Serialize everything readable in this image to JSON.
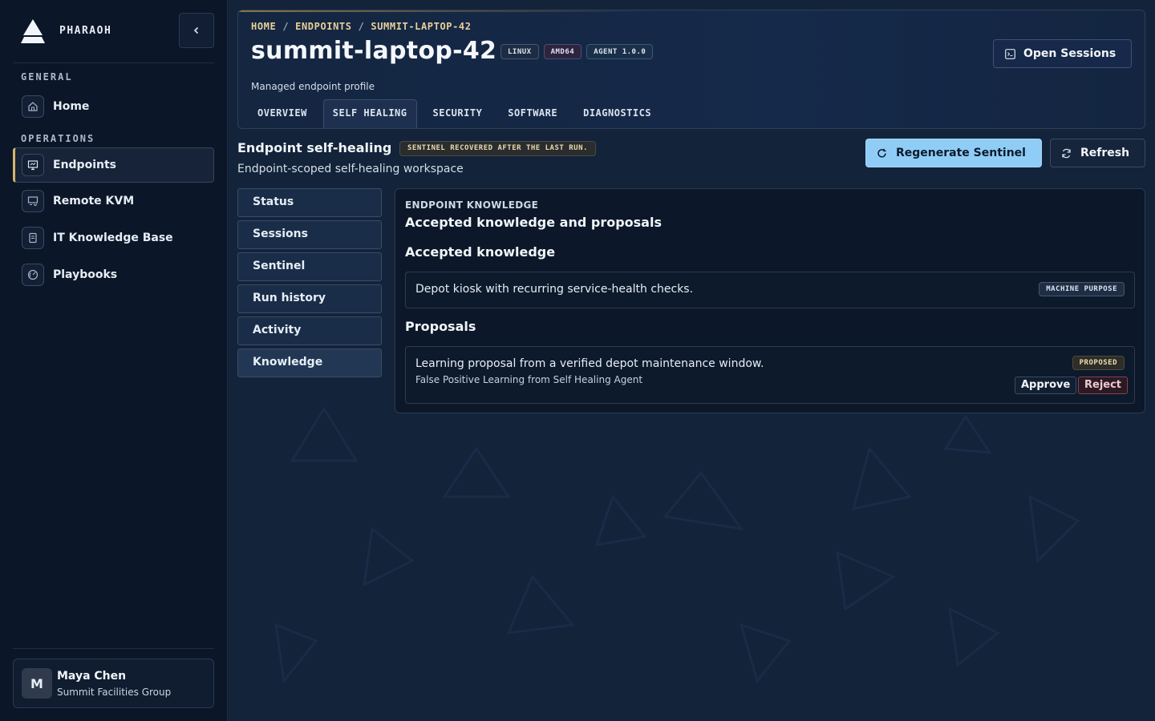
{
  "brand": {
    "name": "PHARAOH"
  },
  "sidebar": {
    "sections": [
      {
        "label": "GENERAL"
      },
      {
        "label": "OPERATIONS"
      }
    ],
    "items": [
      {
        "label": "Home",
        "icon": "home-icon"
      },
      {
        "label": "Endpoints",
        "icon": "monitor-icon",
        "active": true
      },
      {
        "label": "Remote KVM",
        "icon": "remote-screen-icon"
      },
      {
        "label": "IT Knowledge Base",
        "icon": "book-icon"
      },
      {
        "label": "Playbooks",
        "icon": "gauge-icon"
      }
    ],
    "user": {
      "initial": "M",
      "name": "Maya Chen",
      "org": "Summit Facilities Group"
    }
  },
  "header": {
    "breadcrumb": [
      "HOME",
      "ENDPOINTS",
      "SUMMIT-LAPTOP-42"
    ],
    "title": "summit-laptop-42",
    "tags": [
      "LINUX",
      "AMD64",
      "AGENT 1.0.0"
    ],
    "subtitle": "Managed endpoint profile",
    "open_sessions_label": "Open Sessions",
    "tabs": [
      {
        "label": "OVERVIEW"
      },
      {
        "label": "SELF HEALING",
        "active": true
      },
      {
        "label": "SECURITY"
      },
      {
        "label": "SOFTWARE"
      },
      {
        "label": "DIAGNOSTICS"
      }
    ]
  },
  "self_healing": {
    "title": "Endpoint self-healing",
    "badge": "SENTINEL RECOVERED AFTER THE LAST RUN.",
    "subtitle": "Endpoint-scoped self-healing workspace",
    "regenerate_label": "Regenerate Sentinel",
    "refresh_label": "Refresh",
    "subnav": [
      {
        "label": "Status"
      },
      {
        "label": "Sessions"
      },
      {
        "label": "Sentinel"
      },
      {
        "label": "Run history"
      },
      {
        "label": "Activity"
      },
      {
        "label": "Knowledge",
        "active": true
      }
    ]
  },
  "knowledge": {
    "eyebrow": "ENDPOINT KNOWLEDGE",
    "title": "Accepted knowledge and proposals",
    "accepted_title": "Accepted knowledge",
    "accepted": [
      {
        "text": "Depot kiosk with recurring service-health checks.",
        "tag": "MACHINE PURPOSE"
      }
    ],
    "proposals_title": "Proposals",
    "proposals": [
      {
        "text": "Learning proposal from a verified depot maintenance window.",
        "meta": "False Positive Learning from Self Healing Agent",
        "status": "PROPOSED",
        "approve_label": "Approve",
        "reject_label": "Reject"
      }
    ]
  },
  "colors": {
    "accent": "#8fcdf6",
    "gold": "#d8b46a",
    "background": "#12233a",
    "sidebar": "#0b1628"
  }
}
